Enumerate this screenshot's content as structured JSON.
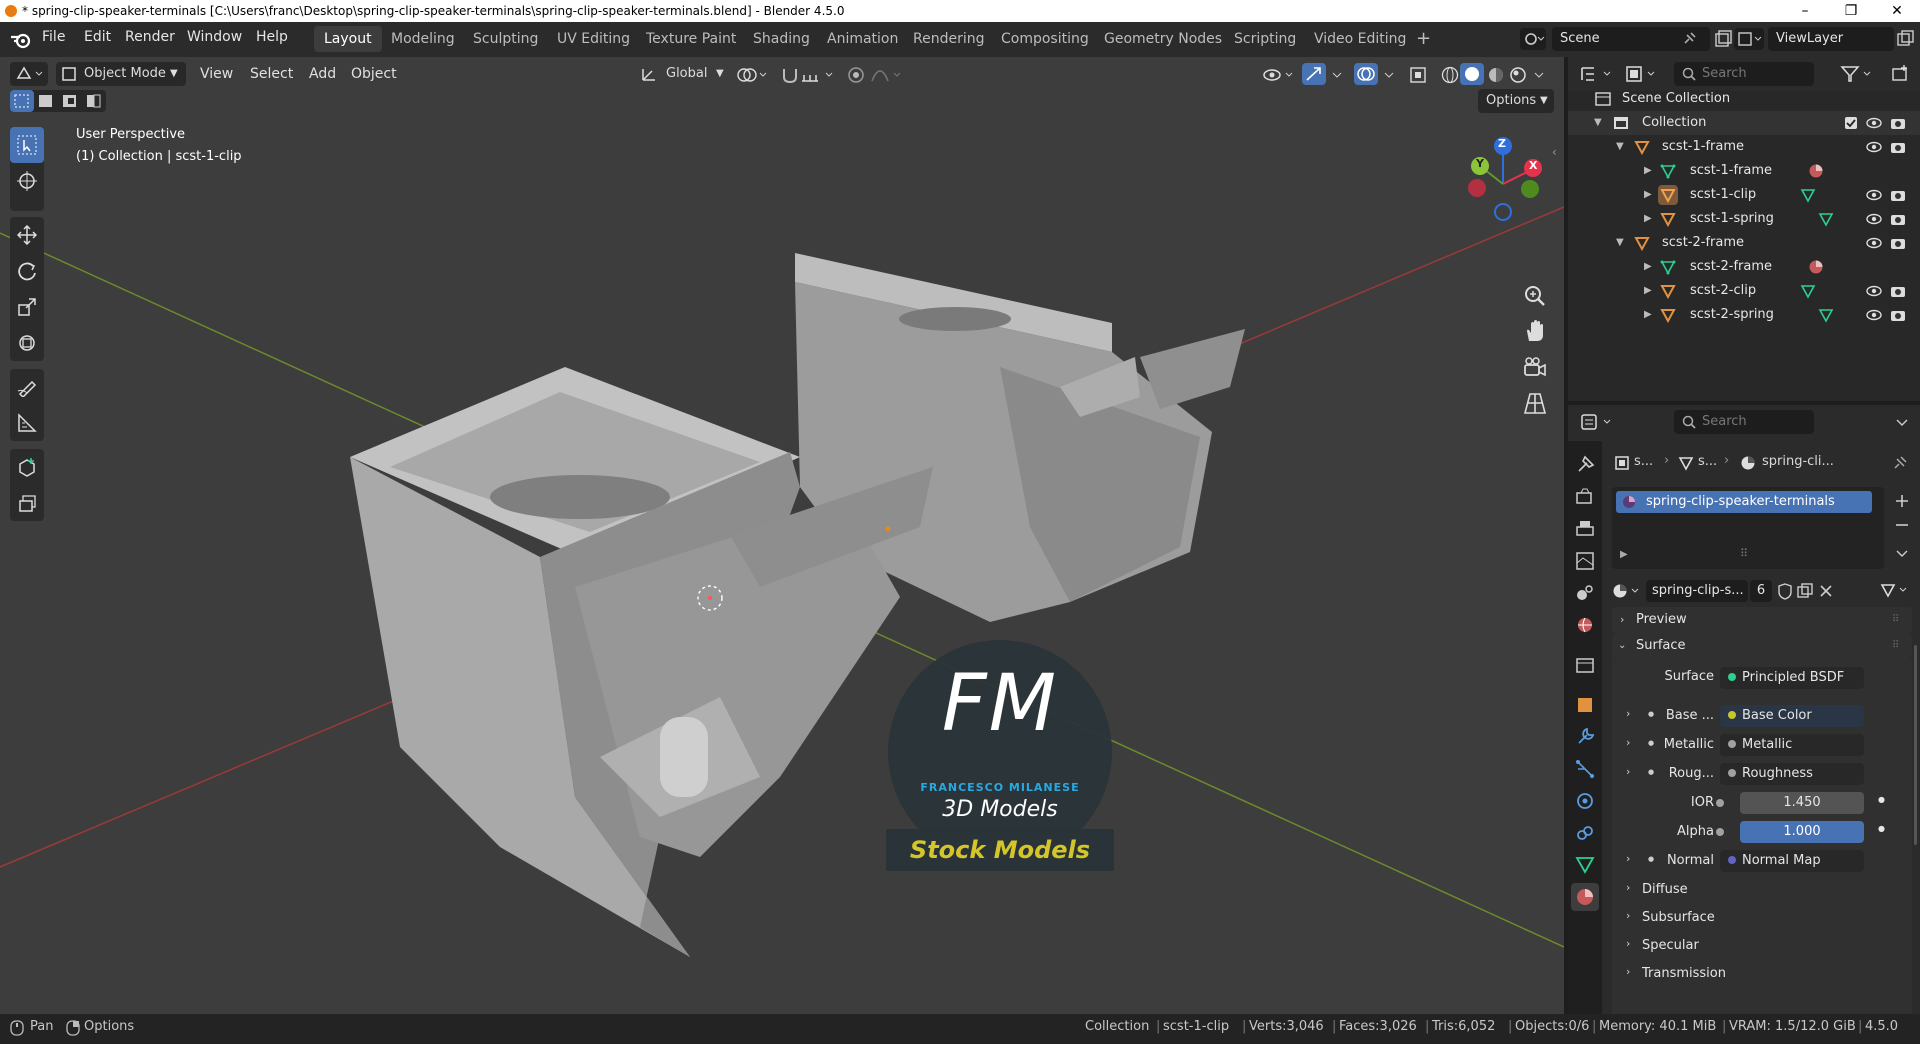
{
  "window": {
    "title": "* spring-clip-speaker-terminals [C:\\Users\\franc\\Desktop\\spring-clip-speaker-terminals\\spring-clip-speaker-terminals.blend] - Blender 4.5.0",
    "minimize": "–",
    "maximize": "❐",
    "close": "✕"
  },
  "menu": [
    "File",
    "Edit",
    "Render",
    "Window",
    "Help"
  ],
  "workspaces": [
    "Layout",
    "Modeling",
    "Sculpting",
    "UV Editing",
    "Texture Paint",
    "Shading",
    "Animation",
    "Rendering",
    "Compositing",
    "Geometry Nodes",
    "Scripting",
    "Video Editing"
  ],
  "workspace_add": "+",
  "scene": "Scene",
  "view_layer": "ViewLayer",
  "viewport": {
    "mode": "Object Mode",
    "menus": [
      "View",
      "Select",
      "Add",
      "Object"
    ],
    "transform_orientation": "Global",
    "options_label": "Options",
    "overlay_view": "User Perspective",
    "overlay_context": "(1) Collection | scst-1-clip",
    "gizmo": {
      "x": "X",
      "y": "Y",
      "z": "Z"
    },
    "watermark": {
      "letters": "FM",
      "name": "FRANCESCO MILANESE",
      "sub": "3D Models",
      "badge": "Stock Models"
    }
  },
  "outliner": {
    "search_placeholder": "Search",
    "rows": [
      {
        "label": "Scene Collection",
        "indent": 0,
        "icon": "scene-collection"
      },
      {
        "label": "Collection",
        "indent": 1,
        "icon": "collection",
        "expanded": true
      },
      {
        "label": "scst-1-frame",
        "indent": 2,
        "icon": "object",
        "expanded": true
      },
      {
        "label": "scst-1-frame",
        "indent": 3,
        "icon": "mesh"
      },
      {
        "label": "scst-1-clip",
        "indent": 3,
        "icon": "object"
      },
      {
        "label": "scst-1-spring",
        "indent": 3,
        "icon": "object"
      },
      {
        "label": "scst-2-frame",
        "indent": 2,
        "icon": "object",
        "expanded": true
      },
      {
        "label": "scst-2-frame",
        "indent": 3,
        "icon": "mesh"
      },
      {
        "label": "scst-2-clip",
        "indent": 3,
        "icon": "object"
      },
      {
        "label": "scst-2-spring",
        "indent": 3,
        "icon": "object"
      }
    ]
  },
  "properties": {
    "search_placeholder": "Search",
    "breadcrumb": [
      "s...",
      "s...",
      "spring-cli..."
    ],
    "material_slot": "spring-clip-speaker-terminals",
    "material_name": "spring-clip-s...",
    "users": "6",
    "panels": {
      "preview": "Preview",
      "surface": "Surface"
    },
    "surface": {
      "label": "Surface",
      "value": "Principled BSDF"
    },
    "inputs": [
      {
        "label": "Base ...",
        "value": "Base Color",
        "dot": "#c7c729"
      },
      {
        "label": "Metallic",
        "value": "Metallic",
        "dot": "#a1a1a1"
      },
      {
        "label": "Roug...",
        "value": "Roughness",
        "dot": "#a1a1a1"
      }
    ],
    "ior": {
      "label": "IOR",
      "value": "1.450"
    },
    "alpha": {
      "label": "Alpha",
      "value": "1.000"
    },
    "normal": {
      "label": "Normal",
      "value": "Normal Map"
    },
    "subpanels": [
      "Diffuse",
      "Subsurface",
      "Specular",
      "Transmission"
    ]
  },
  "status": {
    "pan": "Pan",
    "options": "Options",
    "collection": "Collection",
    "object": "scst-1-clip",
    "verts": "Verts:3,046",
    "faces": "Faces:3,026",
    "tris": "Tris:6,052",
    "objects": "Objects:0/6",
    "memory": "Memory: 40.1 MiB",
    "vram": "VRAM: 1.5/12.0 GiB",
    "version": "4.5.0"
  },
  "colors": {
    "accent": "#4772b3",
    "mesh": "#2bd18f",
    "object": "#e0923f",
    "material": "#c55a5a"
  }
}
